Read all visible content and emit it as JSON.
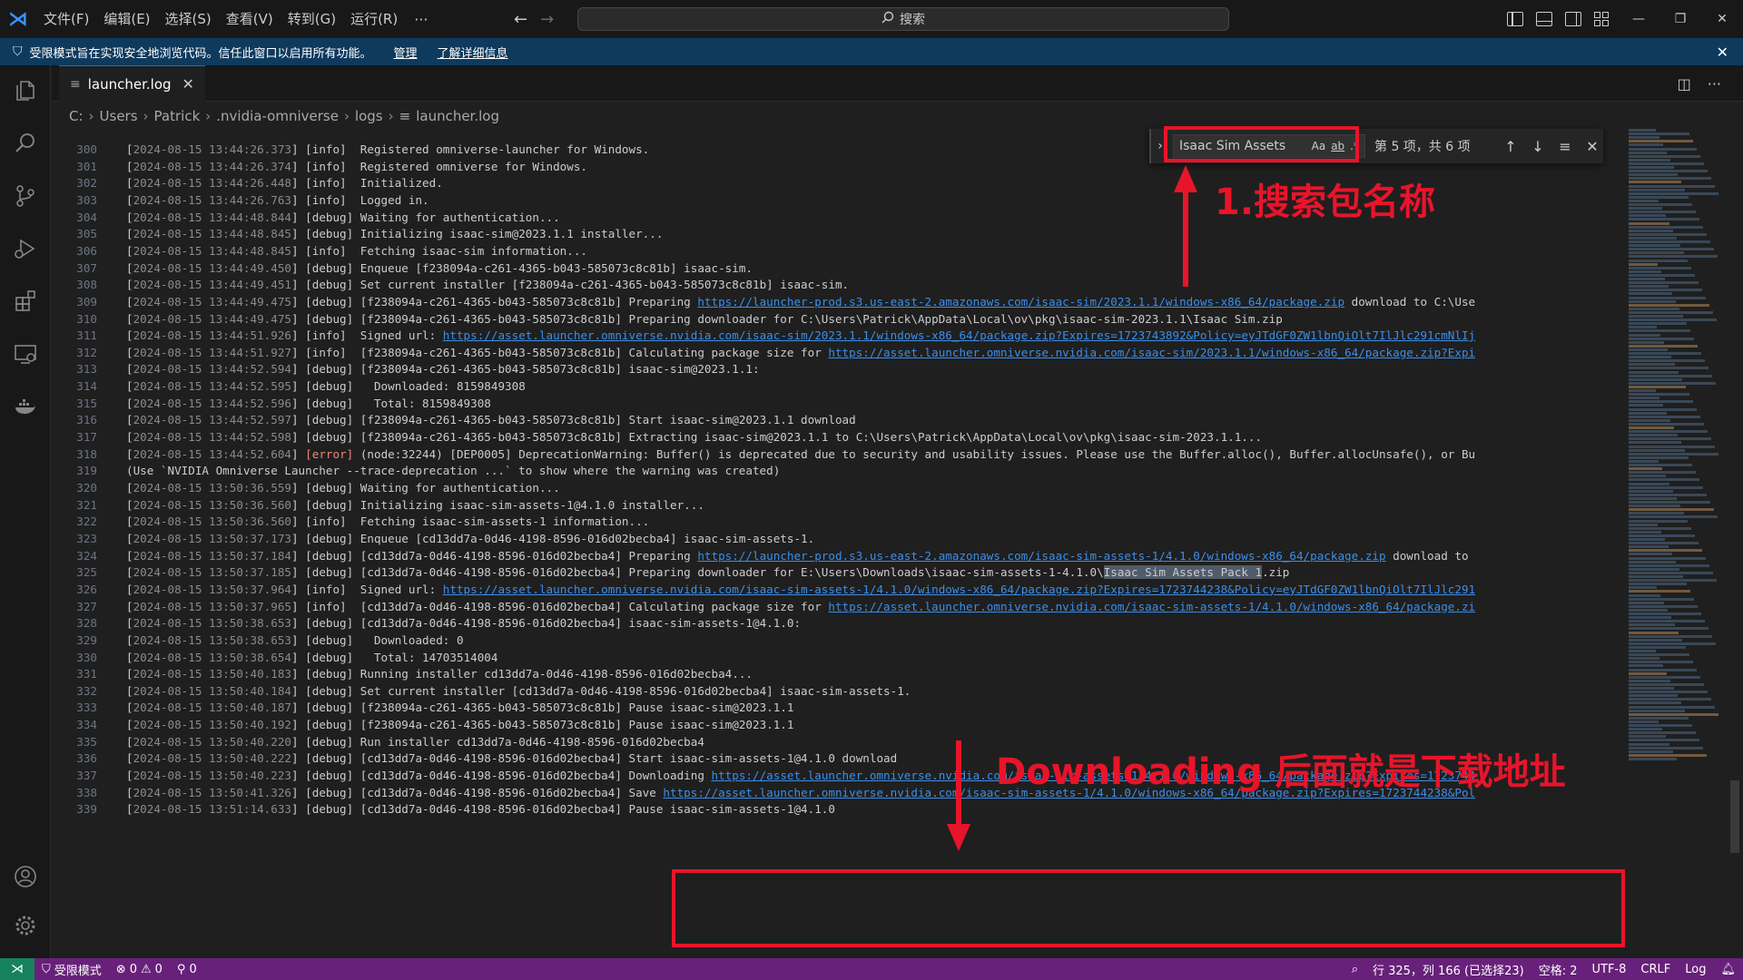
{
  "titlebar": {
    "menu": [
      "文件(F)",
      "编辑(E)",
      "选择(S)",
      "查看(V)",
      "转到(G)",
      "运行(R)"
    ],
    "more": "···",
    "search_label": "搜索"
  },
  "banner": {
    "message": "受限模式旨在实现安全地浏览代码。信任此窗口以启用所有功能。",
    "manage": "管理",
    "learn_more": "了解详细信息"
  },
  "tab": {
    "label": "launcher.log"
  },
  "breadcrumbs": [
    "C:",
    "Users",
    "Patrick",
    ".nvidia-omniverse",
    "logs",
    "launcher.log"
  ],
  "find": {
    "query": "Isaac Sim Assets",
    "opt_case": "Aa",
    "opt_word": "ab",
    "opt_regex": ".*",
    "count": "第 5 项，共 6 项"
  },
  "code_lines": [
    {
      "n": "300",
      "t": "[2024-08-15 13:44:26.373] [info]  Registered omniverse-launcher for Windows."
    },
    {
      "n": "301",
      "t": "[2024-08-15 13:44:26.374] [info]  Registered omniverse for Windows."
    },
    {
      "n": "302",
      "t": "[2024-08-15 13:44:26.448] [info]  Initialized."
    },
    {
      "n": "303",
      "t": "[2024-08-15 13:44:26.763] [info]  Logged in."
    },
    {
      "n": "304",
      "t": "[2024-08-15 13:44:48.844] [debug] Waiting for authentication..."
    },
    {
      "n": "305",
      "t": "[2024-08-15 13:44:48.845] [debug] Initializing isaac-sim@2023.1.1 installer..."
    },
    {
      "n": "306",
      "t": "[2024-08-15 13:44:48.845] [info]  Fetching isaac-sim information..."
    },
    {
      "n": "307",
      "t": "[2024-08-15 13:44:49.450] [debug] Enqueue [f238094a-c261-4365-b043-585073c8c81b] isaac-sim."
    },
    {
      "n": "308",
      "t": "[2024-08-15 13:44:49.451] [debug] Set current installer [f238094a-c261-4365-b043-585073c8c81b] isaac-sim."
    },
    {
      "n": "309",
      "t": "[2024-08-15 13:44:49.475] [debug] [f238094a-c261-4365-b043-585073c8c81b] Preparing https://launcher-prod.s3.us-east-2.amazonaws.com/isaac-sim/2023.1.1/windows-x86_64/package.zip download to C:\\Use"
    },
    {
      "n": "310",
      "t": "[2024-08-15 13:44:49.475] [debug] [f238094a-c261-4365-b043-585073c8c81b] Preparing downloader for C:\\Users\\Patrick\\AppData\\Local\\ov\\pkg\\isaac-sim-2023.1.1\\Isaac Sim.zip"
    },
    {
      "n": "311",
      "t": "[2024-08-15 13:44:51.926] [info]  Signed url: https://asset.launcher.omniverse.nvidia.com/isaac-sim/2023.1.1/windows-x86_64/package.zip?Expires=1723743892&Policy=eyJTdGF0ZW1lbnQiOlt7IlJlc291cmNlIj"
    },
    {
      "n": "312",
      "t": "[2024-08-15 13:44:51.927] [info]  [f238094a-c261-4365-b043-585073c8c81b] Calculating package size for https://asset.launcher.omniverse.nvidia.com/isaac-sim/2023.1.1/windows-x86_64/package.zip?Expi"
    },
    {
      "n": "313",
      "t": "[2024-08-15 13:44:52.594] [debug] [f238094a-c261-4365-b043-585073c8c81b] isaac-sim@2023.1.1:"
    },
    {
      "n": "314",
      "t": "[2024-08-15 13:44:52.595] [debug]   Downloaded: 8159849308"
    },
    {
      "n": "315",
      "t": "[2024-08-15 13:44:52.596] [debug]   Total: 8159849308"
    },
    {
      "n": "316",
      "t": "[2024-08-15 13:44:52.597] [debug] [f238094a-c261-4365-b043-585073c8c81b] Start isaac-sim@2023.1.1 download"
    },
    {
      "n": "317",
      "t": "[2024-08-15 13:44:52.598] [debug] [f238094a-c261-4365-b043-585073c8c81b] Extracting isaac-sim@2023.1.1 to C:\\Users\\Patrick\\AppData\\Local\\ov\\pkg\\isaac-sim-2023.1.1..."
    },
    {
      "n": "318",
      "t": "[2024-08-15 13:44:52.604] [error] (node:32244) [DEP0005] DeprecationWarning: Buffer() is deprecated due to security and usability issues. Please use the Buffer.alloc(), Buffer.allocUnsafe(), or Bu"
    },
    {
      "n": "319",
      "t": "(Use `NVIDIA Omniverse Launcher --trace-deprecation ...` to show where the warning was created)"
    },
    {
      "n": "320",
      "t": "[2024-08-15 13:50:36.559] [debug] Waiting for authentication..."
    },
    {
      "n": "321",
      "t": "[2024-08-15 13:50:36.560] [debug] Initializing isaac-sim-assets-1@4.1.0 installer..."
    },
    {
      "n": "322",
      "t": "[2024-08-15 13:50:36.560] [info]  Fetching isaac-sim-assets-1 information..."
    },
    {
      "n": "323",
      "t": "[2024-08-15 13:50:37.173] [debug] Enqueue [cd13dd7a-0d46-4198-8596-016d02becba4] isaac-sim-assets-1."
    },
    {
      "n": "324",
      "t": "[2024-08-15 13:50:37.184] [debug] [cd13dd7a-0d46-4198-8596-016d02becba4] Preparing https://launcher-prod.s3.us-east-2.amazonaws.com/isaac-sim-assets-1/4.1.0/windows-x86_64/package.zip download to"
    },
    {
      "n": "325",
      "t": "[2024-08-15 13:50:37.185] [debug] [cd13dd7a-0d46-4198-8596-016d02becba4] Preparing downloader for E:\\Users\\Downloads\\isaac-sim-assets-1-4.1.0\\Isaac Sim Assets Pack 1.zip"
    },
    {
      "n": "326",
      "t": "[2024-08-15 13:50:37.964] [info]  Signed url: https://asset.launcher.omniverse.nvidia.com/isaac-sim-assets-1/4.1.0/windows-x86_64/package.zip?Expires=1723744238&Policy=eyJTdGF0ZW1lbnQiOlt7IlJlc291"
    },
    {
      "n": "327",
      "t": "[2024-08-15 13:50:37.965] [info]  [cd13dd7a-0d46-4198-8596-016d02becba4] Calculating package size for https://asset.launcher.omniverse.nvidia.com/isaac-sim-assets-1/4.1.0/windows-x86_64/package.zi"
    },
    {
      "n": "328",
      "t": "[2024-08-15 13:50:38.653] [debug] [cd13dd7a-0d46-4198-8596-016d02becba4] isaac-sim-assets-1@4.1.0:"
    },
    {
      "n": "329",
      "t": "[2024-08-15 13:50:38.653] [debug]   Downloaded: 0"
    },
    {
      "n": "330",
      "t": "[2024-08-15 13:50:38.654] [debug]   Total: 14703514004"
    },
    {
      "n": "331",
      "t": "[2024-08-15 13:50:40.183] [debug] Running installer cd13dd7a-0d46-4198-8596-016d02becba4..."
    },
    {
      "n": "332",
      "t": "[2024-08-15 13:50:40.184] [debug] Set current installer [cd13dd7a-0d46-4198-8596-016d02becba4] isaac-sim-assets-1."
    },
    {
      "n": "333",
      "t": "[2024-08-15 13:50:40.187] [debug] [f238094a-c261-4365-b043-585073c8c81b] Pause isaac-sim@2023.1.1"
    },
    {
      "n": "334",
      "t": "[2024-08-15 13:50:40.192] [debug] [f238094a-c261-4365-b043-585073c8c81b] Pause isaac-sim@2023.1.1"
    },
    {
      "n": "335",
      "t": "[2024-08-15 13:50:40.220] [debug] Run installer cd13dd7a-0d46-4198-8596-016d02becba4"
    },
    {
      "n": "336",
      "t": "[2024-08-15 13:50:40.222] [debug] [cd13dd7a-0d46-4198-8596-016d02becba4] Start isaac-sim-assets-1@4.1.0 download"
    },
    {
      "n": "337",
      "t": "[2024-08-15 13:50:40.223] [debug] [cd13dd7a-0d46-4198-8596-016d02becba4] Downloading https://asset.launcher.omniverse.nvidia.com/isaac-sim-assets-1/4.1.0/windows-x86_64/package.zip?Expires=1723744"
    },
    {
      "n": "338",
      "t": "[2024-08-15 13:50:41.326] [debug] [cd13dd7a-0d46-4198-8596-016d02becba4] Save https://asset.launcher.omniverse.nvidia.com/isaac-sim-assets-1/4.1.0/windows-x86_64/package.zip?Expires=1723744238&Pol"
    },
    {
      "n": "339",
      "t": "[2024-08-15 13:51:14.633] [debug] [cd13dd7a-0d46-4198-8596-016d02becba4] Pause isaac-sim-assets-1@4.1.0"
    }
  ],
  "annotations": {
    "search_note": "1.搜索包名称",
    "download_note": "Downloading 后面就是下载地址",
    "color": "#e8142a"
  },
  "statusbar": {
    "restricted": "受限模式",
    "errors": "0",
    "warnings": "0",
    "ports": "0",
    "position": "行 325，列 166 (已选择23)",
    "indent": "空格: 2",
    "encoding": "UTF-8",
    "eol": "CRLF",
    "language": "Log"
  },
  "colors": {
    "accent": "#0078d4",
    "banner": "#0e3a5e",
    "statusbar": "#68217a",
    "link": "#3b8eea"
  }
}
